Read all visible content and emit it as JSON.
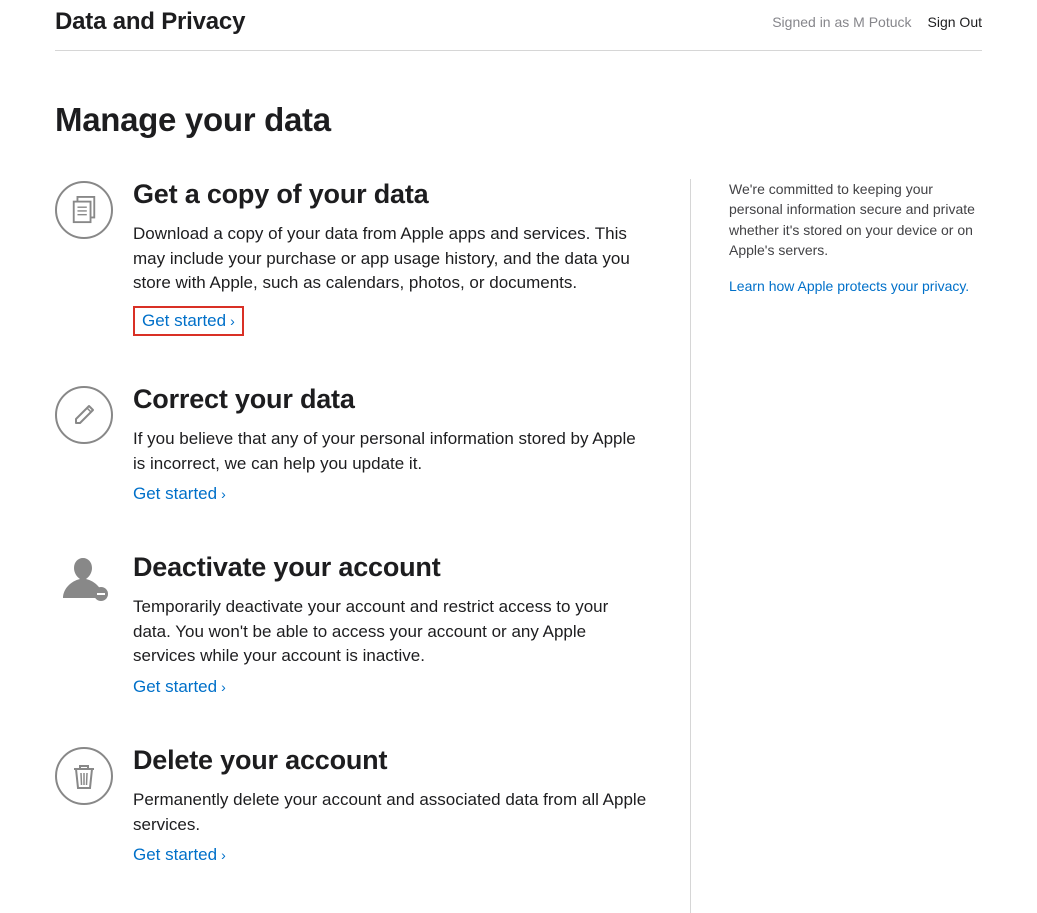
{
  "header": {
    "title": "Data and Privacy",
    "signed_in": "Signed in as M Potuck",
    "sign_out": "Sign Out"
  },
  "page": {
    "title": "Manage your data"
  },
  "sections": [
    {
      "title": "Get a copy of your data",
      "desc": "Download a copy of your data from Apple apps and services. This may include your purchase or app usage history, and the data you store with Apple, such as calendars, photos, or documents.",
      "link": "Get started"
    },
    {
      "title": "Correct your data",
      "desc": "If you believe that any of your personal information stored by Apple is incorrect, we can help you update it.",
      "link": "Get started"
    },
    {
      "title": "Deactivate your account",
      "desc": "Temporarily deactivate your account and restrict access to your data. You won't be able to access your account or any Apple services while your account is inactive.",
      "link": "Get started"
    },
    {
      "title": "Delete your account",
      "desc": "Permanently delete your account and associated data from all Apple services.",
      "link": "Get started"
    }
  ],
  "sidebar": {
    "text": "We're committed to keeping your personal information secure and private whether it's stored on your device or on Apple's servers.",
    "link": "Learn how Apple protects your privacy."
  }
}
